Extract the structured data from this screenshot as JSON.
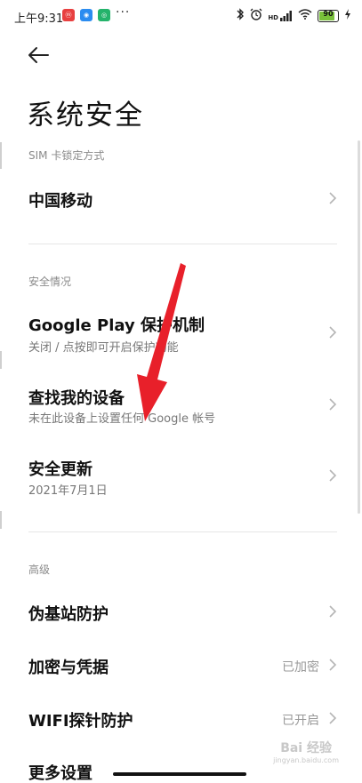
{
  "status_bar": {
    "time": "上午9:31",
    "dots": "···",
    "hd_label": "HD",
    "battery_level": "90"
  },
  "header": {
    "title": "系统安全"
  },
  "sections": {
    "sim": {
      "header": "SIM 卡锁定方式",
      "items": [
        {
          "title": "中国移动"
        }
      ]
    },
    "security_status": {
      "header": "安全情况",
      "items": [
        {
          "title": "Google Play 保护机制",
          "subtitle": "关闭 / 点按即可开启保护功能"
        },
        {
          "title": "查找我的设备",
          "subtitle": "未在此设备上设置任何 Google 帐号"
        },
        {
          "title": "安全更新",
          "subtitle": "2021年7月1日"
        }
      ]
    },
    "advanced": {
      "header": "高级",
      "items": [
        {
          "title": "伪基站防护",
          "value": ""
        },
        {
          "title": "加密与凭据",
          "value": "已加密"
        },
        {
          "title": "WIFI探针防护",
          "value": "已开启"
        },
        {
          "title": "更多设置"
        }
      ]
    }
  },
  "watermark": {
    "line1": "Bai 经验",
    "line2": "jingyan.baidu.com"
  },
  "colors": {
    "annotation_arrow": "#e8202a",
    "battery_fill": "#79c13a"
  }
}
